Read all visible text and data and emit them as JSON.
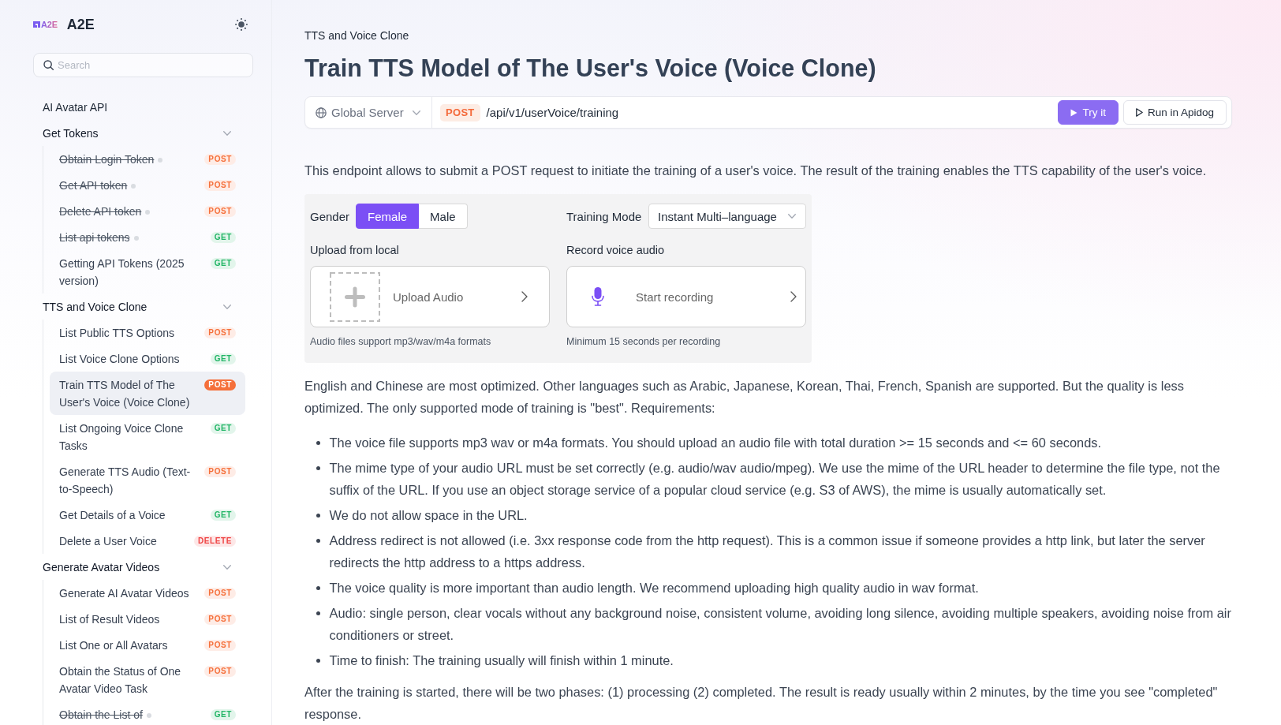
{
  "sidebar": {
    "logo": {
      "text": "A2E"
    },
    "title": "A2E",
    "search": {
      "placeholder": "Search"
    },
    "nav": [
      {
        "kind": "link",
        "label": "AI Avatar API"
      },
      {
        "kind": "group",
        "label": "Get Tokens",
        "expanded": true,
        "children": [
          {
            "label": "Obtain Login Token",
            "deprecated": true,
            "method": "POST",
            "color": "#f5703b",
            "selected": false
          },
          {
            "label": "Get API token",
            "deprecated": true,
            "method": "POST",
            "color": "#f5703b",
            "selected": false
          },
          {
            "label": "Delete API token",
            "deprecated": true,
            "method": "POST",
            "color": "#f5703b",
            "selected": false
          },
          {
            "label": "List api tokens",
            "deprecated": true,
            "method": "GET",
            "color": "#22b566",
            "selected": false
          },
          {
            "label": "Getting API Tokens (2025 version)",
            "deprecated": false,
            "method": "GET",
            "color": "#22b566",
            "selected": false
          }
        ]
      },
      {
        "kind": "group",
        "label": "TTS and Voice Clone",
        "expanded": true,
        "children": [
          {
            "label": "List Public TTS Options",
            "deprecated": false,
            "method": "POST",
            "color": "#f5703b",
            "selected": false
          },
          {
            "label": "List Voice Clone Options",
            "deprecated": false,
            "method": "GET",
            "color": "#22b566",
            "selected": false
          },
          {
            "label": "Train TTS Model of The User's Voice (Voice Clone)",
            "deprecated": false,
            "method": "POST",
            "color": "#f5703b",
            "selected": true
          },
          {
            "label": "List Ongoing Voice Clone Tasks",
            "deprecated": false,
            "method": "GET",
            "color": "#22b566",
            "selected": false
          },
          {
            "label": "Generate TTS Audio (Text-to-Speech)",
            "deprecated": false,
            "method": "POST",
            "color": "#f5703b",
            "selected": false
          },
          {
            "label": "Get Details of a Voice",
            "deprecated": false,
            "method": "GET",
            "color": "#22b566",
            "selected": false
          },
          {
            "label": "Delete a User Voice",
            "deprecated": false,
            "method": "DELETE",
            "color": "#ef4444",
            "selected": false
          }
        ]
      },
      {
        "kind": "group",
        "label": "Generate Avatar Videos",
        "expanded": true,
        "children": [
          {
            "label": "Generate AI Avatar Videos",
            "deprecated": false,
            "method": "POST",
            "color": "#f5703b",
            "selected": false
          },
          {
            "label": "List of Result Videos",
            "deprecated": false,
            "method": "POST",
            "color": "#f5703b",
            "selected": false
          },
          {
            "label": "List One or All Avatars",
            "deprecated": false,
            "method": "POST",
            "color": "#f5703b",
            "selected": false
          },
          {
            "label": "Obtain the Status of One Avatar Video Task",
            "deprecated": false,
            "method": "POST",
            "color": "#f5703b",
            "selected": false
          },
          {
            "label": "Obtain the List of",
            "deprecated": true,
            "method": "GET",
            "color": "#22b566",
            "selected": false
          }
        ]
      }
    ]
  },
  "main": {
    "breadcrumb": "TTS and Voice Clone",
    "title": "Train TTS Model of The User's Voice (Voice Clone)",
    "request_bar": {
      "server": "Global Server",
      "method": "POST",
      "path": "/api/v1/userVoice/training",
      "buttons": [
        {
          "kind": "primary",
          "label": "Try it"
        },
        {
          "kind": "secondary",
          "label": "Run in Apidog"
        }
      ]
    },
    "intro": "This endpoint allows to submit a POST request to initiate the training of a user's voice. The result of the training enables the TTS capability of the user's voice.",
    "demo": {
      "gender": {
        "label": "Gender",
        "options": [
          {
            "label": "Female",
            "selected": true
          },
          {
            "label": "Male",
            "selected": false
          }
        ]
      },
      "training_mode": {
        "label": "Training Mode",
        "value": "Instant Multi–language"
      },
      "upload": {
        "heading": "Upload from local",
        "action": "Upload Audio",
        "hint": "Audio files support mp3/wav/m4a formats"
      },
      "record": {
        "heading": "Record voice audio",
        "action": "Start recording",
        "hint": "Minimum 15 seconds per recording"
      }
    },
    "notes": "English and Chinese are most optimized. Other languages such as Arabic, Japanese, Korean, Thai, French, Spanish are supported. But the quality is less optimized. The only supported mode of training is \"best\". Requirements:",
    "requirements": [
      "The voice file supports mp3 wav or m4a formats. You should upload an audio file with total duration >= 15 seconds and <= 60 seconds.",
      "The mime type of your audio URL must be set correctly (e.g. audio/wav audio/mpeg). We use the mime of the URL header to determine the file type, not the suffix of the URL. If you use an object storage service of a popular cloud service (e.g. S3 of AWS), the mime is usually automatically set.",
      "We do not allow space in the URL.",
      "Address redirect is not allowed (i.e. 3xx response code from the http request). This is a common issue if someone provides a http link, but later the server redirects the http address to a https address.",
      "The voice quality is more important than audio length. We recommend uploading high quality audio in wav format.",
      "Audio: single person, clear vocals without any background noise, consistent volume, avoiding long silence, avoiding multiple speakers, avoiding noise from air conditioners or street.",
      "Time to finish: The training usually will finish within 1 minute."
    ],
    "closing": "After the training is started, there will be two phases: (1) processing (2) completed. The result is ready usually within 2 minutes, by the time you see \"completed\" response."
  }
}
